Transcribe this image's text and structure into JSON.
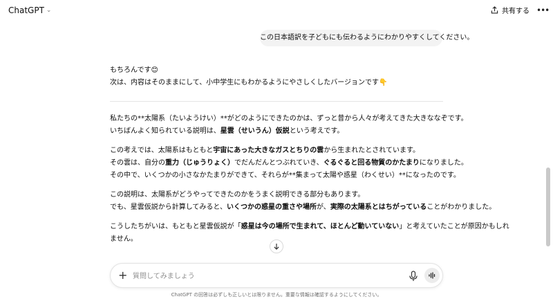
{
  "header": {
    "model_name": "ChatGPT",
    "share_label": "共有する"
  },
  "conversation": {
    "user_message": "この日本語訳を子どもにも伝わるようにわかりやすくしてください。",
    "intro": {
      "line1": "もちろんです😊",
      "line2": "次は、内容はそのままにして、小中学生にもわかるようにやさしくしたバージョンです👇"
    },
    "p1": {
      "l1": "私たちの**太陽系（たいようけい）**がどのようにできたのかは、ずっと昔から人々が考えてきた大きななぞです。",
      "l2_a": "いちばんよく知られている説明は、",
      "l2_b": "星雲（せいうん）仮説",
      "l2_c": "という考えです。"
    },
    "p2": {
      "l1_a": "この考えでは、太陽系はもともと",
      "l1_b": "宇宙にあった大きなガスとちりの雲",
      "l1_c": "から生まれたとされています。",
      "l2_a": "その雲は、自分の",
      "l2_b": "重力（じゅうりょく）",
      "l2_c": "でだんだんとつぶれていき、",
      "l2_d": "ぐるぐると回る物質のかたまり",
      "l2_e": "になりました。",
      "l3": "その中で、いくつかの小さなかたまりができて、それらが**集まって太陽や惑星（わくせい）**になったのです。"
    },
    "p3": {
      "l1": "この説明は、太陽系がどうやってできたのかをうまく説明できる部分もあります。",
      "l2_a": "でも、星雲仮説から計算してみると、",
      "l2_b": "いくつかの惑星の重さや場所",
      "l2_c": "が、",
      "l2_d": "実際の太陽系とはちがっている",
      "l2_e": "ことがわかりました。"
    },
    "p4": {
      "l1_a": "こうしたちがいは、もともと星雲仮説が「",
      "l1_b": "惑星は今の場所で生まれて、ほとんど動いていない",
      "l1_c": "」と考えていたことが原因かもしれ",
      "l2": "ません。"
    }
  },
  "composer": {
    "placeholder": "質問してみましょう"
  },
  "footer": {
    "disclaimer": "ChatGPT の回答は必ずしも正しいとは限りません。重要な情報は確認するようにしてください。"
  },
  "icons": {
    "chevron": "chevron-down-icon",
    "share": "share-icon",
    "more": "more-icon",
    "scroll_down": "arrow-down-icon",
    "plus": "plus-icon",
    "mic": "microphone-icon",
    "voice": "voice-mode-icon"
  }
}
